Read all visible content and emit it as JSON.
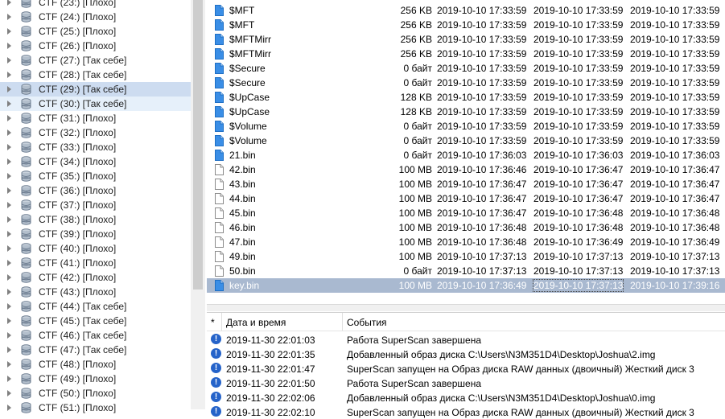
{
  "tree": {
    "items": [
      {
        "label": "CTF (23:) [Плохо]"
      },
      {
        "label": "CTF (24:) [Плохо]"
      },
      {
        "label": "CTF (25:) [Плохо]"
      },
      {
        "label": "CTF (26:) [Плохо]"
      },
      {
        "label": "CTF (27:) [Так себе]"
      },
      {
        "label": "CTF (28:) [Так себе]"
      },
      {
        "label": "CTF (29:) [Так себе]",
        "state": "selected"
      },
      {
        "label": "CTF (30:) [Так себе]",
        "state": "hover"
      },
      {
        "label": "CTF (31:) [Плохо]"
      },
      {
        "label": "CTF (32:) [Плохо]"
      },
      {
        "label": "CTF (33:) [Плохо]"
      },
      {
        "label": "CTF (34:) [Плохо]"
      },
      {
        "label": "CTF (35:) [Плохо]"
      },
      {
        "label": "CTF (36:) [Плохо]"
      },
      {
        "label": "CTF (37:) [Плохо]"
      },
      {
        "label": "CTF (38:) [Плохо]"
      },
      {
        "label": "CTF (39:) [Плохо]"
      },
      {
        "label": "CTF (40:) [Плохо]"
      },
      {
        "label": "CTF (41:) [Плохо]"
      },
      {
        "label": "CTF (42:) [Плохо]"
      },
      {
        "label": "CTF (43:) [Плохо]"
      },
      {
        "label": "CTF (44:) [Так себе]"
      },
      {
        "label": "CTF (45:) [Так себе]"
      },
      {
        "label": "CTF (46:) [Так себе]"
      },
      {
        "label": "CTF (47:) [Так себе]"
      },
      {
        "label": "CTF (48:) [Плохо]"
      },
      {
        "label": "CTF (49:) [Плохо]"
      },
      {
        "label": "CTF (50:) [Плохо]"
      },
      {
        "label": "CTF (51:) [Плохо]"
      }
    ]
  },
  "files": {
    "rows": [
      {
        "icon": "blue",
        "name": "$MFT",
        "size": "256 KB",
        "created": "2019-10-10 17:33:59",
        "modified": "2019-10-10 17:33:59",
        "accessed": "2019-10-10 17:33:59"
      },
      {
        "icon": "blue",
        "name": "$MFT",
        "size": "256 KB",
        "created": "2019-10-10 17:33:59",
        "modified": "2019-10-10 17:33:59",
        "accessed": "2019-10-10 17:33:59"
      },
      {
        "icon": "blue",
        "name": "$MFTMirr",
        "size": "256 KB",
        "created": "2019-10-10 17:33:59",
        "modified": "2019-10-10 17:33:59",
        "accessed": "2019-10-10 17:33:59"
      },
      {
        "icon": "blue",
        "name": "$MFTMirr",
        "size": "256 KB",
        "created": "2019-10-10 17:33:59",
        "modified": "2019-10-10 17:33:59",
        "accessed": "2019-10-10 17:33:59"
      },
      {
        "icon": "blue",
        "name": "$Secure",
        "size": "0 байт",
        "created": "2019-10-10 17:33:59",
        "modified": "2019-10-10 17:33:59",
        "accessed": "2019-10-10 17:33:59"
      },
      {
        "icon": "blue",
        "name": "$Secure",
        "size": "0 байт",
        "created": "2019-10-10 17:33:59",
        "modified": "2019-10-10 17:33:59",
        "accessed": "2019-10-10 17:33:59"
      },
      {
        "icon": "blue",
        "name": "$UpCase",
        "size": "128 KB",
        "created": "2019-10-10 17:33:59",
        "modified": "2019-10-10 17:33:59",
        "accessed": "2019-10-10 17:33:59"
      },
      {
        "icon": "blue",
        "name": "$UpCase",
        "size": "128 KB",
        "created": "2019-10-10 17:33:59",
        "modified": "2019-10-10 17:33:59",
        "accessed": "2019-10-10 17:33:59"
      },
      {
        "icon": "blue",
        "name": "$Volume",
        "size": "0 байт",
        "created": "2019-10-10 17:33:59",
        "modified": "2019-10-10 17:33:59",
        "accessed": "2019-10-10 17:33:59"
      },
      {
        "icon": "blue",
        "name": "$Volume",
        "size": "0 байт",
        "created": "2019-10-10 17:33:59",
        "modified": "2019-10-10 17:33:59",
        "accessed": "2019-10-10 17:33:59"
      },
      {
        "icon": "blue",
        "name": "21.bin",
        "size": "0 байт",
        "created": "2019-10-10 17:36:03",
        "modified": "2019-10-10 17:36:03",
        "accessed": "2019-10-10 17:36:03"
      },
      {
        "icon": "white",
        "name": "42.bin",
        "size": "100 MB",
        "created": "2019-10-10 17:36:46",
        "modified": "2019-10-10 17:36:47",
        "accessed": "2019-10-10 17:36:47"
      },
      {
        "icon": "white",
        "name": "43.bin",
        "size": "100 MB",
        "created": "2019-10-10 17:36:47",
        "modified": "2019-10-10 17:36:47",
        "accessed": "2019-10-10 17:36:47"
      },
      {
        "icon": "white",
        "name": "44.bin",
        "size": "100 MB",
        "created": "2019-10-10 17:36:47",
        "modified": "2019-10-10 17:36:47",
        "accessed": "2019-10-10 17:36:47"
      },
      {
        "icon": "white",
        "name": "45.bin",
        "size": "100 MB",
        "created": "2019-10-10 17:36:47",
        "modified": "2019-10-10 17:36:48",
        "accessed": "2019-10-10 17:36:48"
      },
      {
        "icon": "white",
        "name": "46.bin",
        "size": "100 MB",
        "created": "2019-10-10 17:36:48",
        "modified": "2019-10-10 17:36:48",
        "accessed": "2019-10-10 17:36:48"
      },
      {
        "icon": "white",
        "name": "47.bin",
        "size": "100 MB",
        "created": "2019-10-10 17:36:48",
        "modified": "2019-10-10 17:36:49",
        "accessed": "2019-10-10 17:36:49"
      },
      {
        "icon": "white",
        "name": "49.bin",
        "size": "100 MB",
        "created": "2019-10-10 17:37:13",
        "modified": "2019-10-10 17:37:13",
        "accessed": "2019-10-10 17:37:13"
      },
      {
        "icon": "white",
        "name": "50.bin",
        "size": "0 байт",
        "created": "2019-10-10 17:37:13",
        "modified": "2019-10-10 17:37:13",
        "accessed": "2019-10-10 17:37:13"
      },
      {
        "icon": "blue",
        "name": "key.bin",
        "size": "100 MB",
        "created": "2019-10-10 17:36:49",
        "modified": "2019-10-10 17:37:13",
        "accessed": "2019-10-10 17:39:16",
        "state": "selected"
      }
    ]
  },
  "log": {
    "headers": {
      "marker": "*",
      "time": "Дата и время",
      "event": "События"
    },
    "rows": [
      {
        "time": "2019-11-30 22:01:03",
        "msg": "Работа SuperScan завершена"
      },
      {
        "time": "2019-11-30 22:01:35",
        "msg": "Добавленный образ диска C:\\Users\\N3M351D4\\Desktop\\Joshua\\2.img"
      },
      {
        "time": "2019-11-30 22:01:47",
        "msg": "SuperScan запущен на Образ диска RAW данных (двоичный) Жесткий диск 3"
      },
      {
        "time": "2019-11-30 22:01:50",
        "msg": "Работа SuperScan завершена"
      },
      {
        "time": "2019-11-30 22:02:06",
        "msg": "Добавленный образ диска C:\\Users\\N3M351D4\\Desktop\\Joshua\\0.img"
      },
      {
        "time": "2019-11-30 22:02:10",
        "msg": "SuperScan запущен на Образ диска RAW данных (двоичный) Жесткий диск 3"
      }
    ]
  },
  "colors": {
    "selection": "#cddcf0",
    "file_selection": "#a9b9d0",
    "info_icon": "#2563c9",
    "disk_icon": "#6f7f92"
  }
}
